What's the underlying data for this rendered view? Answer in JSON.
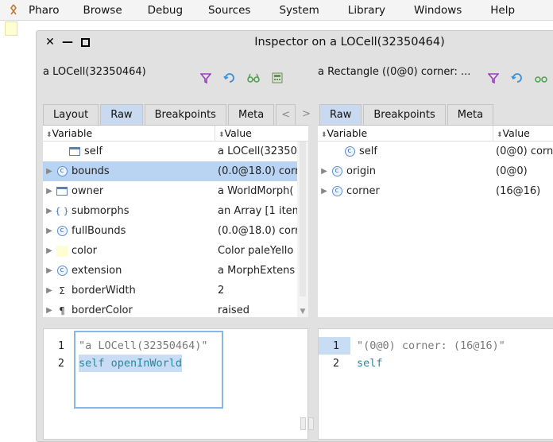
{
  "menubar": {
    "items": [
      "Pharo",
      "Browse",
      "Debug",
      "Sources",
      "System",
      "Library",
      "Windows",
      "Help"
    ]
  },
  "window": {
    "title": "Inspector on a LOCell(32350464)"
  },
  "left_pane": {
    "object_label": "a LOCell(32350464)",
    "tabs": [
      "Layout",
      "Raw",
      "Breakpoints",
      "Meta"
    ],
    "active_tab": "Raw",
    "columns": {
      "variable": "Variable",
      "value": "Value"
    },
    "rows": [
      {
        "name": "self",
        "value": "a LOCell(32350",
        "icon": "window-icon",
        "expandable": false,
        "selected": false
      },
      {
        "name": "bounds",
        "value": "(0.0@18.0) corr",
        "icon": "class-c-icon",
        "expandable": true,
        "selected": true
      },
      {
        "name": "owner",
        "value": "a WorldMorph(",
        "icon": "window-icon",
        "expandable": true,
        "selected": false
      },
      {
        "name": "submorphs",
        "value": "an Array [1 item",
        "icon": "collection-icon",
        "expandable": true,
        "selected": false
      },
      {
        "name": "fullBounds",
        "value": "(0.0@18.0) corr",
        "icon": "class-c-icon",
        "expandable": true,
        "selected": false
      },
      {
        "name": "color",
        "value": "Color paleYello",
        "icon": "color-swatch-icon",
        "expandable": true,
        "selected": false
      },
      {
        "name": "extension",
        "value": "a MorphExtens",
        "icon": "class-c-icon",
        "expandable": true,
        "selected": false
      },
      {
        "name": "borderWidth",
        "value": "2",
        "icon": "sigma-icon",
        "expandable": true,
        "selected": false
      },
      {
        "name": "borderColor",
        "value": "raised",
        "icon": "pilcrow-icon",
        "expandable": true,
        "selected": false
      }
    ],
    "editor": {
      "lines": [
        {
          "num": "1",
          "text": "\"a LOCell(32350464)\""
        },
        {
          "num": "2",
          "text": "self openInWorld"
        }
      ]
    }
  },
  "right_pane": {
    "object_label": "a Rectangle ((0@0) corner: ...",
    "tabs": [
      "Raw",
      "Breakpoints",
      "Meta"
    ],
    "active_tab": "Raw",
    "columns": {
      "variable": "Variable",
      "value": "Value"
    },
    "rows": [
      {
        "name": "self",
        "value": "(0@0) corne",
        "icon": "class-c-icon",
        "expandable": false
      },
      {
        "name": "origin",
        "value": "(0@0)",
        "icon": "class-c-icon",
        "expandable": true
      },
      {
        "name": "corner",
        "value": "(16@16)",
        "icon": "class-c-icon",
        "expandable": true
      }
    ],
    "editor": {
      "lines": [
        {
          "num": "1",
          "text": "\"(0@0) corner: (16@16)\""
        },
        {
          "num": "2",
          "text": "self"
        }
      ]
    }
  }
}
